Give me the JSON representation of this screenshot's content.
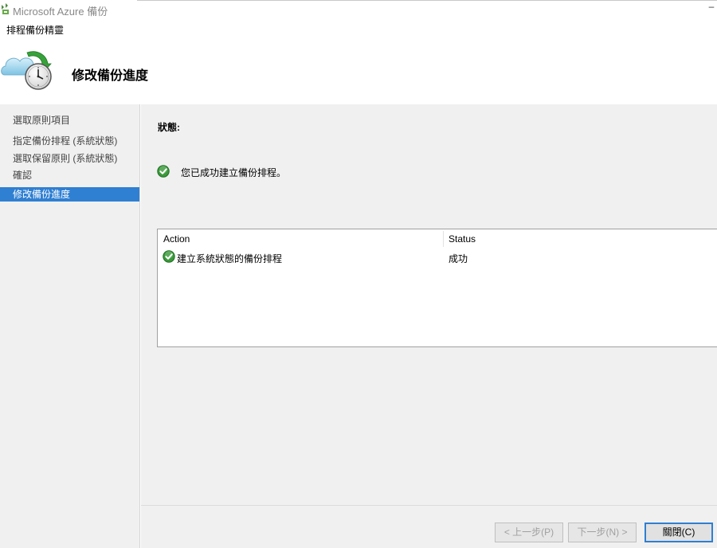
{
  "window": {
    "title": "Microsoft Azure 備份",
    "minimize_glyph": "–",
    "app_icon": "azure-backup-icon"
  },
  "wizard": {
    "title": "排程備份精靈",
    "heading": "修改備份進度",
    "header_icon": "cloud-backup-clock-icon"
  },
  "nav": {
    "items": [
      {
        "label": "選取原則項目",
        "active": false
      },
      {
        "label": "指定備份排程 (系統狀態)",
        "active": false
      },
      {
        "label": "選取保留原則 (系統狀態)",
        "active": false
      },
      {
        "label": "確認",
        "active": false
      },
      {
        "label": "修改備份進度",
        "active": true
      }
    ]
  },
  "status": {
    "label": "狀態:",
    "message": "您已成功建立備份排程。",
    "icon": "success-check-icon"
  },
  "table": {
    "columns": [
      "Action",
      "Status"
    ],
    "rows": [
      {
        "action": "建立系統狀態的備份排程",
        "status": "成功",
        "icon": "success-check-icon"
      }
    ]
  },
  "buttons": {
    "prev": {
      "label": "< 上一步(P)",
      "enabled": false
    },
    "next": {
      "label": "下一步(N) >",
      "enabled": false
    },
    "close": {
      "label": "關閉(C)",
      "enabled": true
    }
  },
  "colors": {
    "accent": "#2f7fd2",
    "success": "#3a9a3a",
    "panel": "#f0f0f0"
  }
}
